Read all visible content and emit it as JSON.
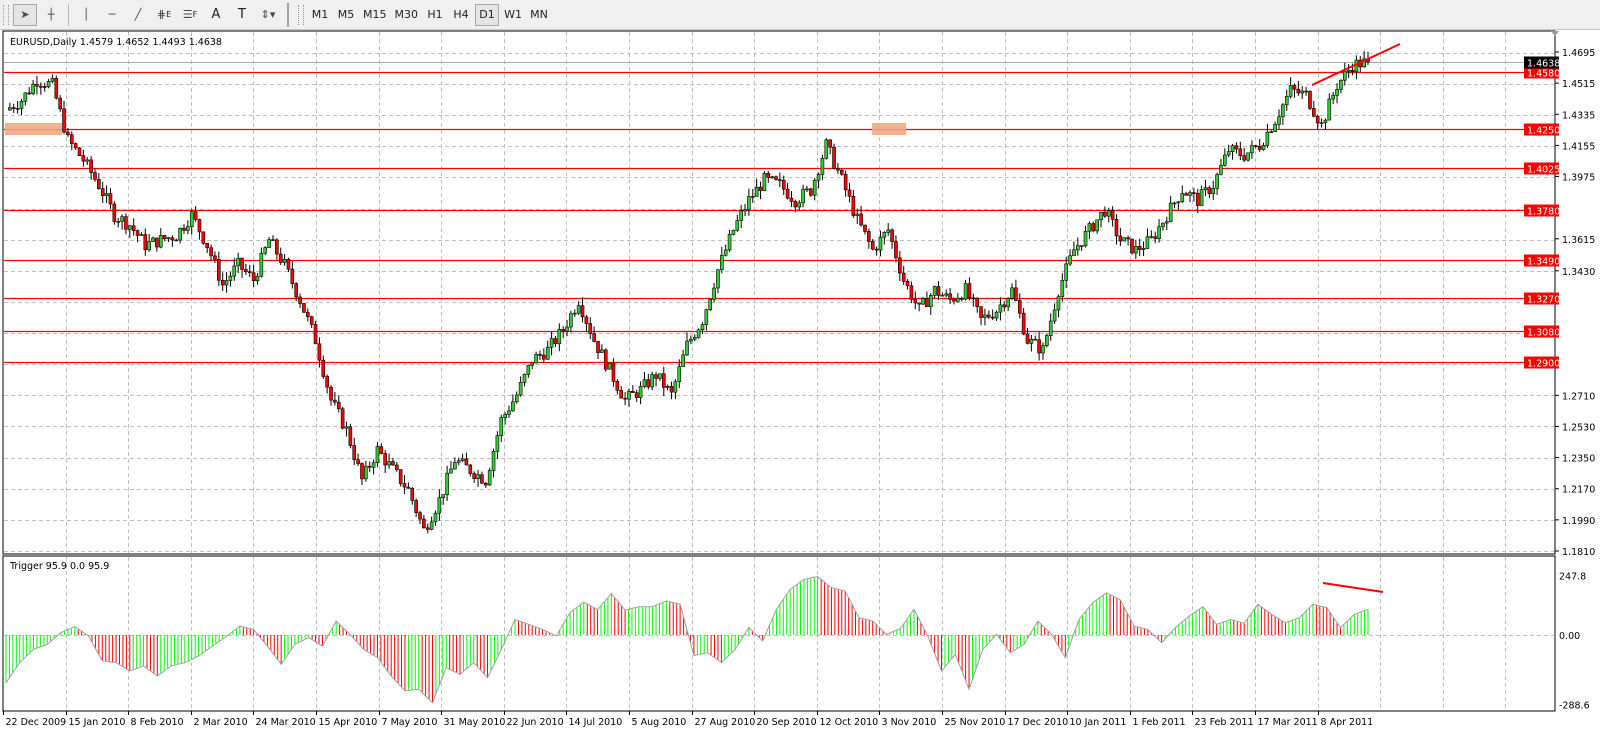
{
  "toolbar": {
    "tools": [
      {
        "icon": "cursor-arrow-icon",
        "label": "",
        "active": true
      },
      {
        "icon": "crosshair-icon",
        "label": ""
      },
      {
        "icon": "vertical-line-icon",
        "label": ""
      },
      {
        "icon": "horizontal-line-icon",
        "label": ""
      },
      {
        "icon": "trendline-icon",
        "label": ""
      },
      {
        "icon": "equidistant-channel-icon",
        "label": "E"
      },
      {
        "icon": "fibonacci-retracement-icon",
        "label": "F"
      },
      {
        "icon": "text-icon",
        "label": "A"
      },
      {
        "icon": "text-label-icon",
        "label": "T"
      },
      {
        "icon": "arrows-dropdown-icon",
        "label": ""
      }
    ],
    "timeframes": [
      {
        "label": "M1"
      },
      {
        "label": "M5"
      },
      {
        "label": "M15"
      },
      {
        "label": "M30"
      },
      {
        "label": "H1"
      },
      {
        "label": "H4"
      },
      {
        "label": "D1",
        "active": true
      },
      {
        "label": "W1"
      },
      {
        "label": "MN"
      }
    ]
  },
  "chart_data": [
    {
      "type": "candlestick",
      "title": "EURUSD,Daily  1.4579 1.4652 1.4493 1.4638",
      "symbol": "EURUSD",
      "period": "Daily",
      "ohlc_last": {
        "open": 1.4579,
        "high": 1.4652,
        "low": 1.4493,
        "close": 1.4638
      },
      "ylim": [
        1.181,
        1.4695
      ],
      "y_ticks": [
        "1.4695",
        "1.4515",
        "1.4335",
        "1.4155",
        "1.3975",
        "1.3615",
        "1.3430",
        "1.2710",
        "1.2530",
        "1.2350",
        "1.2170",
        "1.1990",
        "1.1810"
      ],
      "x_ticks": [
        "22 Dec 2009",
        "15 Jan 2010",
        "8 Feb 2010",
        "2 Mar 2010",
        "24 Mar 2010",
        "15 Apr 2010",
        "7 May 2010",
        "31 May 2010",
        "22 Jun 2010",
        "14 Jul 2010",
        "5 Aug 2010",
        "27 Aug 2010",
        "20 Sep 2010",
        "12 Oct 2010",
        "3 Nov 2010",
        "25 Nov 2010",
        "17 Dec 2010",
        "10 Jan 2011",
        "1 Feb 2011",
        "23 Feb 2011",
        "17 Mar 2011",
        "8 Apr 2011"
      ],
      "grid": true,
      "current_price": "1.4638",
      "horizontal_levels": [
        "1.4580",
        "1.4250",
        "1.4025",
        "1.3780",
        "1.3490",
        "1.3270",
        "1.3080",
        "1.2900"
      ],
      "closes_approx": [
        1.436,
        1.4417,
        1.4533,
        1.4504,
        1.4186,
        1.4071,
        1.3926,
        1.3753,
        1.3695,
        1.3579,
        1.3608,
        1.3637,
        1.3753,
        1.3579,
        1.3348,
        1.3464,
        1.3377,
        1.3608,
        1.3464,
        1.3261,
        1.303,
        1.2683,
        1.251,
        1.222,
        1.2394,
        1.2278,
        1.2163,
        1.1931,
        1.2105,
        1.2336,
        1.2278,
        1.222,
        1.2567,
        1.2712,
        1.2914,
        1.2972,
        1.3088,
        1.3261,
        1.303,
        1.2856,
        1.2683,
        1.2741,
        1.2828,
        1.2712,
        1.3001,
        1.3146,
        1.3435,
        1.3666,
        1.3839,
        1.3955,
        1.3926,
        1.3839,
        1.3897,
        1.4157,
        1.3955,
        1.3724,
        1.355,
        1.3666,
        1.3377,
        1.3203,
        1.3319,
        1.3261,
        1.3319,
        1.3146,
        1.3203,
        1.3319,
        1.303,
        1.2972,
        1.3319,
        1.355,
        1.3666,
        1.3782,
        1.3608,
        1.355,
        1.3608,
        1.3753,
        1.3897,
        1.3839,
        1.3926,
        1.4128,
        1.4099,
        1.4157,
        1.4302,
        1.4475,
        1.4446,
        1.4273,
        1.4504,
        1.462,
        1.4638
      ],
      "highlight_zones": [
        {
          "from": "22 Dec 2009",
          "level": 1.425
        },
        {
          "from": "3 Nov 2010",
          "level": 1.425
        }
      ],
      "colors": {
        "bull": "#32cd32",
        "bear": "#ff0000",
        "levels": "#ff0000",
        "zone": "#f4a582",
        "grid": "#c0c0c0"
      }
    },
    {
      "type": "histogram",
      "title": "Trigger 95.9 0.0 95.9",
      "ylim": [
        -288.6,
        247.8
      ],
      "y_ticks": [
        "247.8",
        "0.00",
        "-288.6"
      ],
      "values_approx": [
        -199,
        -115,
        -60,
        -39,
        10,
        35,
        -4,
        -108,
        -115,
        -150,
        -129,
        -171,
        -129,
        -115,
        -88,
        -46,
        -7,
        37,
        23,
        -46,
        -122,
        -39,
        -11,
        -46,
        58,
        3,
        -60,
        -94,
        -171,
        -233,
        -226,
        -282,
        -136,
        -164,
        -115,
        -178,
        -60,
        65,
        44,
        23,
        -4,
        93,
        137,
        106,
        172,
        104,
        118,
        118,
        142,
        128,
        -85,
        -74,
        -115,
        -60,
        31,
        -25,
        107,
        190,
        232,
        243,
        197,
        183,
        72,
        58,
        3,
        26,
        107,
        -4,
        -150,
        -81,
        -226,
        -60,
        3,
        -74,
        -39,
        58,
        3,
        -94,
        65,
        135,
        176,
        146,
        37,
        23,
        -32,
        31,
        79,
        118,
        44,
        65,
        49,
        128,
        86,
        51,
        72,
        128,
        114,
        31,
        86,
        107
      ],
      "colors": {
        "up": "#00ff00",
        "down": "#ff0000",
        "line": "#a0a0a0",
        "divergence": "#ff0000"
      }
    }
  ]
}
